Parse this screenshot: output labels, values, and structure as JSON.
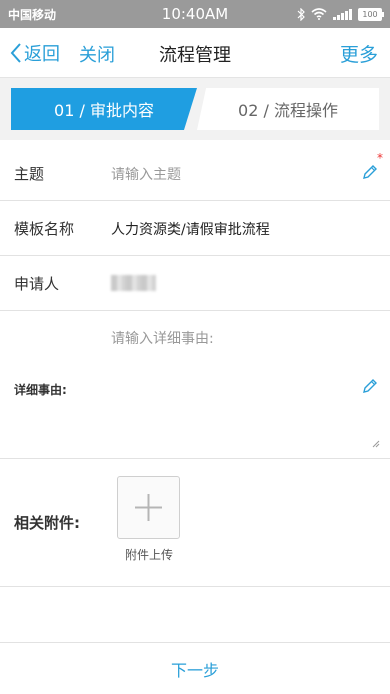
{
  "status": {
    "carrier": "中国移动",
    "time": "10:40AM",
    "battery": "100"
  },
  "nav": {
    "back_label": "返回",
    "close_label": "关闭",
    "title": "流程管理",
    "more_label": "更多"
  },
  "steps": [
    {
      "label": "01 / 审批内容",
      "active": true
    },
    {
      "label": "02 / 流程操作",
      "active": false
    }
  ],
  "form": {
    "subject": {
      "label": "主题",
      "placeholder": "请输入主题",
      "required_mark": "*"
    },
    "template": {
      "label": "模板名称",
      "value": "人力资源类/请假审批流程"
    },
    "applicant": {
      "label": "申请人"
    },
    "detail": {
      "label": "详细事由:",
      "placeholder": "请输入详细事由:"
    },
    "attachment": {
      "label": "相关附件:",
      "upload_caption": "附件上传"
    }
  },
  "footer": {
    "next_label": "下一步"
  },
  "colors": {
    "accent": "#1f9ee1",
    "link": "#2a9fd8",
    "statusbar": "#9a9a9a"
  }
}
